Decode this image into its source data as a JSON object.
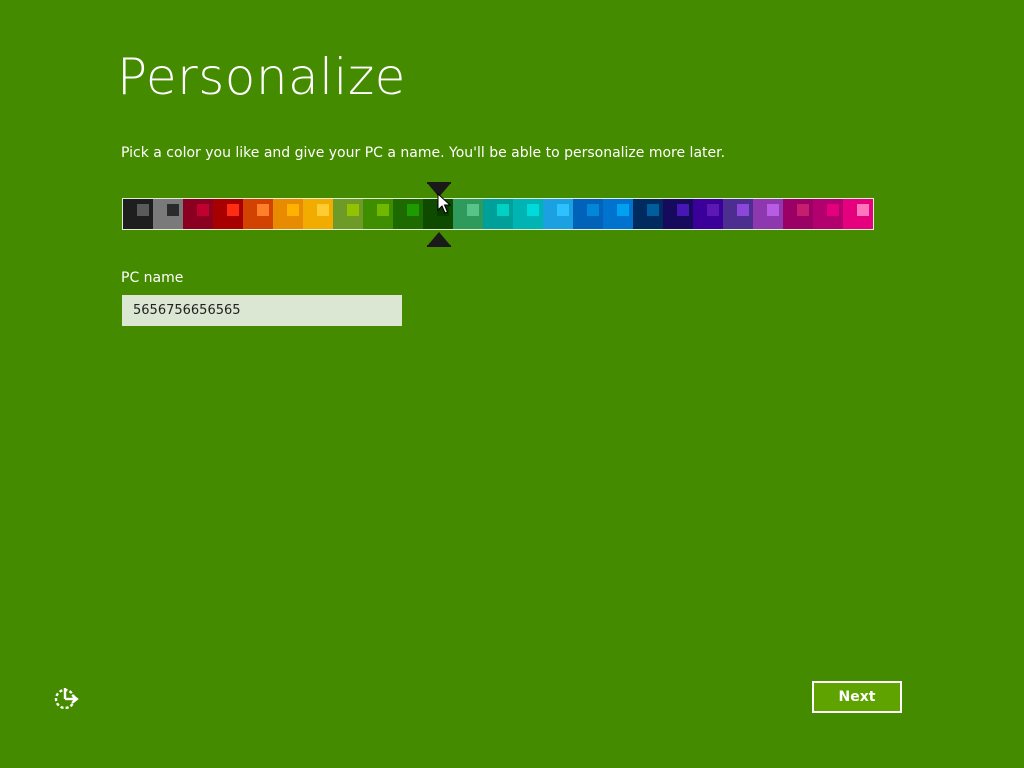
{
  "page": {
    "title": "Personalize",
    "subtitle": "Pick a color you like and give your PC a name. You'll be able to personalize more later.",
    "background_color": "#458b00"
  },
  "palette": {
    "selected_index": 10,
    "swatches": [
      {
        "bg": "#1e1e1e",
        "accent": "#5a5a5a"
      },
      {
        "bg": "#7a7a7a",
        "accent": "#2b2b2b"
      },
      {
        "bg": "#8b0021",
        "accent": "#c0002e"
      },
      {
        "bg": "#a80000",
        "accent": "#ff2e12"
      },
      {
        "bg": "#d24200",
        "accent": "#ff7f2a"
      },
      {
        "bg": "#e88b00",
        "accent": "#ffb300"
      },
      {
        "bg": "#f2ac00",
        "accent": "#ffcc33"
      },
      {
        "bg": "#6e9a27",
        "accent": "#93c300"
      },
      {
        "bg": "#3f8e00",
        "accent": "#71b800"
      },
      {
        "bg": "#1d6b00",
        "accent": "#1d9b00"
      },
      {
        "bg": "#0e4a00",
        "accent": "#073b00"
      },
      {
        "bg": "#2e9a5c",
        "accent": "#58c489"
      },
      {
        "bg": "#00a09a",
        "accent": "#00d1c4"
      },
      {
        "bg": "#00b4b4",
        "accent": "#00dada"
      },
      {
        "bg": "#1ba1e2",
        "accent": "#2dc2ff"
      },
      {
        "bg": "#0062b8",
        "accent": "#0087d8"
      },
      {
        "bg": "#0073cf",
        "accent": "#00a1f1"
      },
      {
        "bg": "#002b5e",
        "accent": "#005e9e"
      },
      {
        "bg": "#150a5c",
        "accent": "#4617b4"
      },
      {
        "bg": "#3b0099",
        "accent": "#5d18b3"
      },
      {
        "bg": "#4b2e8f",
        "accent": "#8c47d8"
      },
      {
        "bg": "#8e38b0",
        "accent": "#b85ce6"
      },
      {
        "bg": "#9b0065",
        "accent": "#c51e6e"
      },
      {
        "bg": "#b3006f",
        "accent": "#e4007c"
      },
      {
        "bg": "#e5007d",
        "accent": "#ff76bc"
      }
    ]
  },
  "pc_name": {
    "label": "PC name",
    "value": "5656756656565"
  },
  "footer": {
    "next_label": "Next",
    "accessibility_icon": "ease-of-access-icon"
  }
}
